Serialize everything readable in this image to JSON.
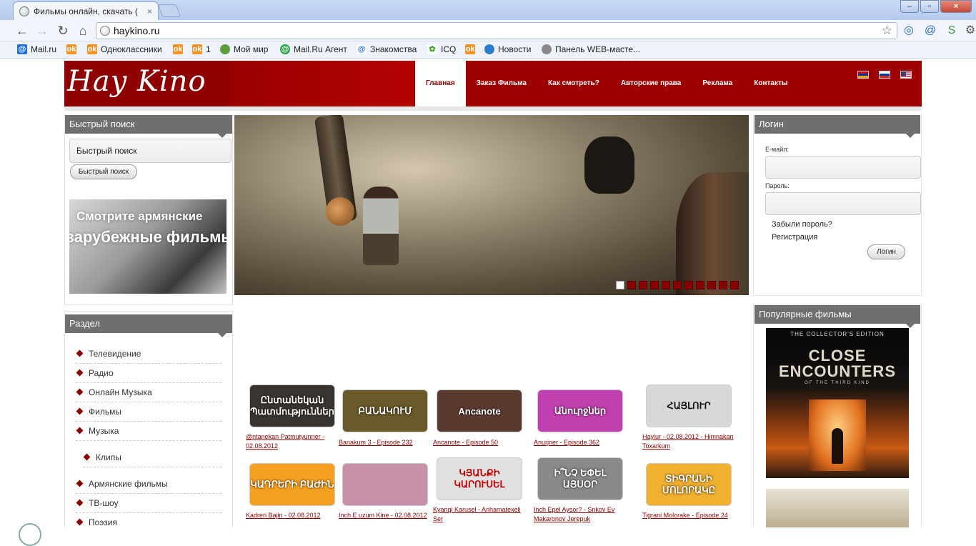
{
  "browser": {
    "tab_title": "Фильмы онлайн, скачать (",
    "tab_close": "×",
    "url": "haykino.ru",
    "window_buttons": [
      "–",
      "▫",
      "×"
    ],
    "bookmarks": [
      {
        "label": "Mail.ru",
        "icon": "mail-ru-icon"
      },
      {
        "label": "",
        "icon": "odnoklassniki-icon"
      },
      {
        "label": "Одноклассники",
        "icon": "odnoklassniki-icon"
      },
      {
        "label": "",
        "icon": "odnoklassniki-icon"
      },
      {
        "label": "1",
        "icon": "odnoklassniki-icon"
      },
      {
        "label": "Мой мир",
        "icon": "moy-mir-icon"
      },
      {
        "label": "Mail.Ru Агент",
        "icon": "mail-agent-icon"
      },
      {
        "label": "Знакомства",
        "icon": "znakomstva-icon"
      },
      {
        "label": "ICQ",
        "icon": "icq-icon"
      },
      {
        "label": "",
        "icon": "odnoklassniki-icon"
      },
      {
        "label": "Новости",
        "icon": "news-icon"
      },
      {
        "label": "Панель WEB-масте...",
        "icon": "web-icon"
      }
    ]
  },
  "site": {
    "logo": "Hay Kino",
    "nav": [
      "Главная",
      "Заказ Фильма",
      "Как смотреть?",
      "Авторские права",
      "Реклама",
      "Контакты"
    ],
    "active_nav": "Главная"
  },
  "quick_search": {
    "title": "Быстрый поиск",
    "input_value": "Быстрый поиск",
    "button": "Быстрый поиск"
  },
  "promo": {
    "line1": "Смотрите армянские",
    "line2": "зарубежные фильмы"
  },
  "slider": {
    "dot_count": 11,
    "active_dot": 0
  },
  "login": {
    "title": "Логин",
    "email_label": "E-майл:",
    "password_label": "Пароль:",
    "forgot": "Забыли пороль?",
    "register": "Регистрация",
    "button": "Логин"
  },
  "section": {
    "title": "Раздел",
    "items": [
      "Телевидение",
      "Радио",
      "Онлайн Музыка",
      "Фильмы",
      "Музыка",
      "Клипы",
      "Армянские фильмы",
      "ТВ-шоу",
      "Поэзия"
    ]
  },
  "thumbnails": [
    {
      "text": "Ընտանեկան Պատմություններ",
      "caption": "@ntanekan Patmutyunner - 02.08.2012",
      "bg": "#3a3430"
    },
    {
      "text": "ԲԱՆԱԿՈՒՄ",
      "caption": "Banakum 3 - Episode 232",
      "bg": "#6a5a2a"
    },
    {
      "text": "Ancanote",
      "caption": "Ancanote - Episode 50",
      "bg": "#5a3a2e"
    },
    {
      "text": "Անուրջներ",
      "caption": "Anurjner - Episode 362",
      "bg": "#c040b0"
    },
    {
      "text": "ՀԱՅԼՈՒՐ",
      "caption": "Haylur - 02.08.2012 - Himnakan Toxarkum",
      "bg": "#d8d8d8"
    },
    {
      "text": "ԿԱԴՐԵՐԻ ԲԱԺԻՆ",
      "caption": "Kadreri Bajin - 02.08.2012",
      "bg": "#f5a020"
    },
    {
      "text": "",
      "caption": "Inch E uzum Kine - 02.08.2012",
      "bg": "#c890a8"
    },
    {
      "text": "ԿՅԱՆՔԻ ԿԱՐՈՒՍԵԼ",
      "caption": "Kyanqi Karusel - Anhamatexeli Ser",
      "bg": "#e0e0e0"
    },
    {
      "text": "Ի՞ՆՉ ԵՓԵԼ ԱՅՍՕՐ",
      "caption": "Inch Epel Aysor? - Snkov Ev Makaronov Jerepuk",
      "bg": "#8a8a8a"
    },
    {
      "text": "ՏԻԳՐԱՆԻ ՄՈԼՈՐԱԿԸ",
      "caption": "Tigrani Molorake - Episode 24",
      "bg": "#f0b030"
    }
  ],
  "popular": {
    "title": "Популярные фильмы",
    "poster_top": "THE COLLECTOR'S EDITION",
    "poster_title": "CLOSE ENCOUNTERS",
    "poster_sub": "OF THE THIRD KIND"
  },
  "colors": {
    "brand_red": "#9e0000",
    "box_header": "#6f6f6f",
    "link": "#8a0000"
  }
}
